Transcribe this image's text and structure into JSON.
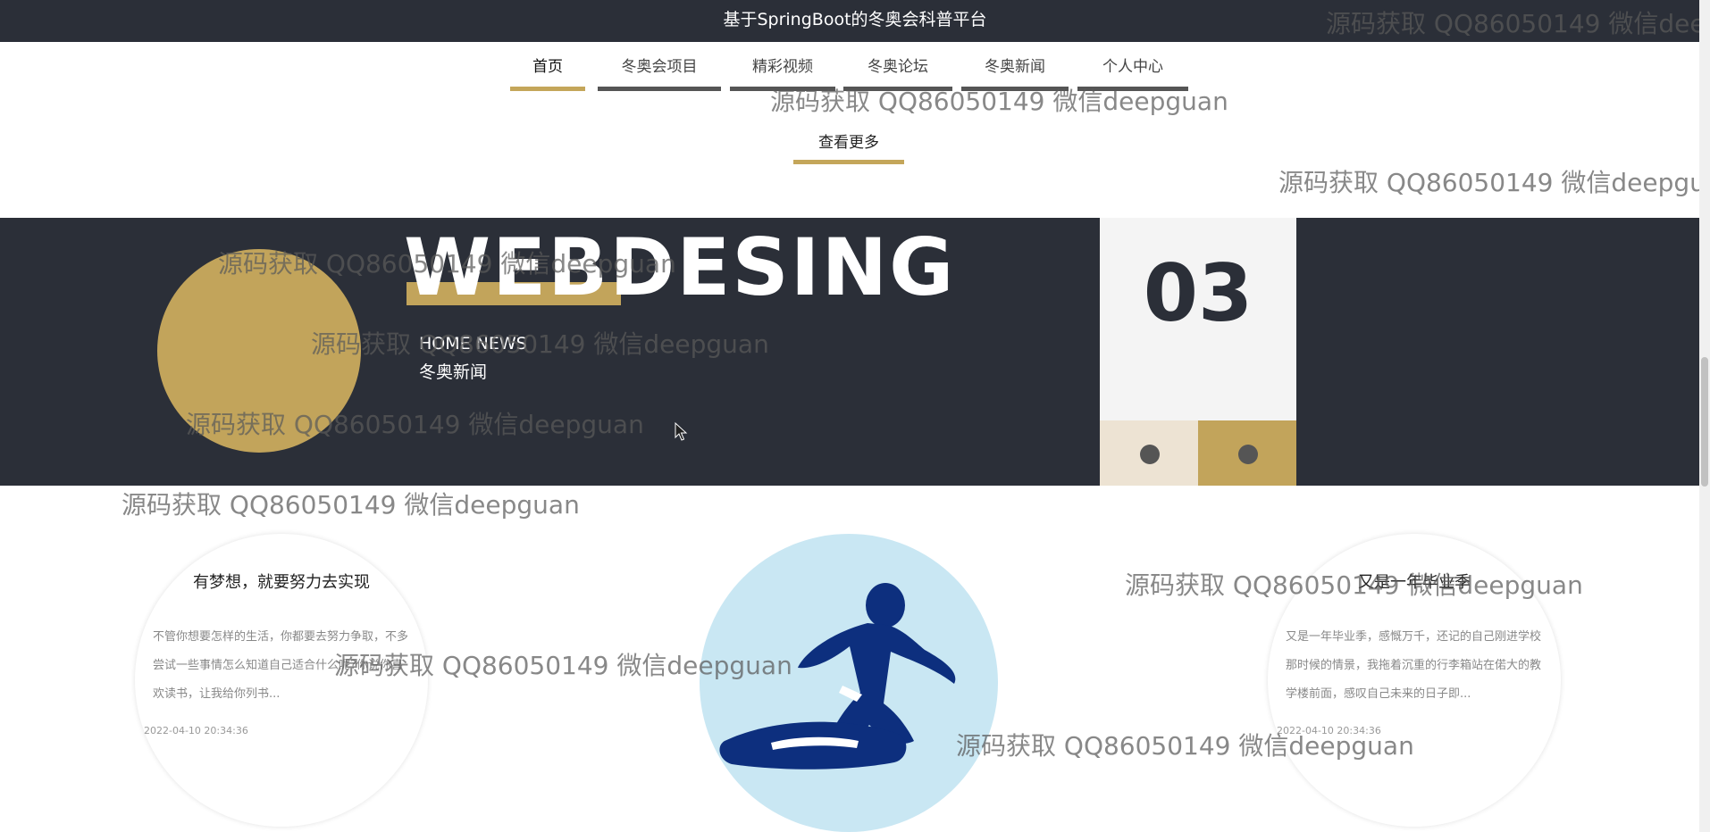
{
  "header": {
    "title": "基于SpringBoot的冬奥会科普平台"
  },
  "nav": {
    "items": [
      {
        "label": "首页"
      },
      {
        "label": "冬奥会项目"
      },
      {
        "label": "精彩视频"
      },
      {
        "label": "冬奥论坛"
      },
      {
        "label": "冬奥新闻"
      },
      {
        "label": "个人中心"
      }
    ]
  },
  "more_link": {
    "label": "查看更多"
  },
  "banner": {
    "big_title": "WEBDESING",
    "subtitle_en": "HOME NEWS",
    "subtitle_cn": "冬奥新闻",
    "counter": "03"
  },
  "cards": [
    {
      "title": "有梦想，就要努力去实现",
      "body": "不管你想要怎样的生活，你都要去努力争取，不多尝试一些事情怎么知道自己适合什么呢?你说你喜欢读书，让我给你列书...",
      "date": "2022-04-10 20:34:36"
    },
    {
      "title": "又是一年毕业季",
      "body": "又是一年毕业季，感慨万千，还记的自己刚进学校那时候的情景，我拖着沉重的行李箱站在偌大的教学楼前面，感叹自己未来的日子即...",
      "date": "2022-04-10 20:34:36"
    }
  ],
  "watermark": "源码获取 QQ86050149 微信deepguan",
  "colors": {
    "dark": "#2b2f38",
    "gold": "#c2a45b",
    "light_blue": "#c9e7f3",
    "snowboarder": "#0d2f7e"
  },
  "icons": {
    "cursor": "mouse-pointer-icon",
    "snowboard": "snowboarder-icon"
  }
}
